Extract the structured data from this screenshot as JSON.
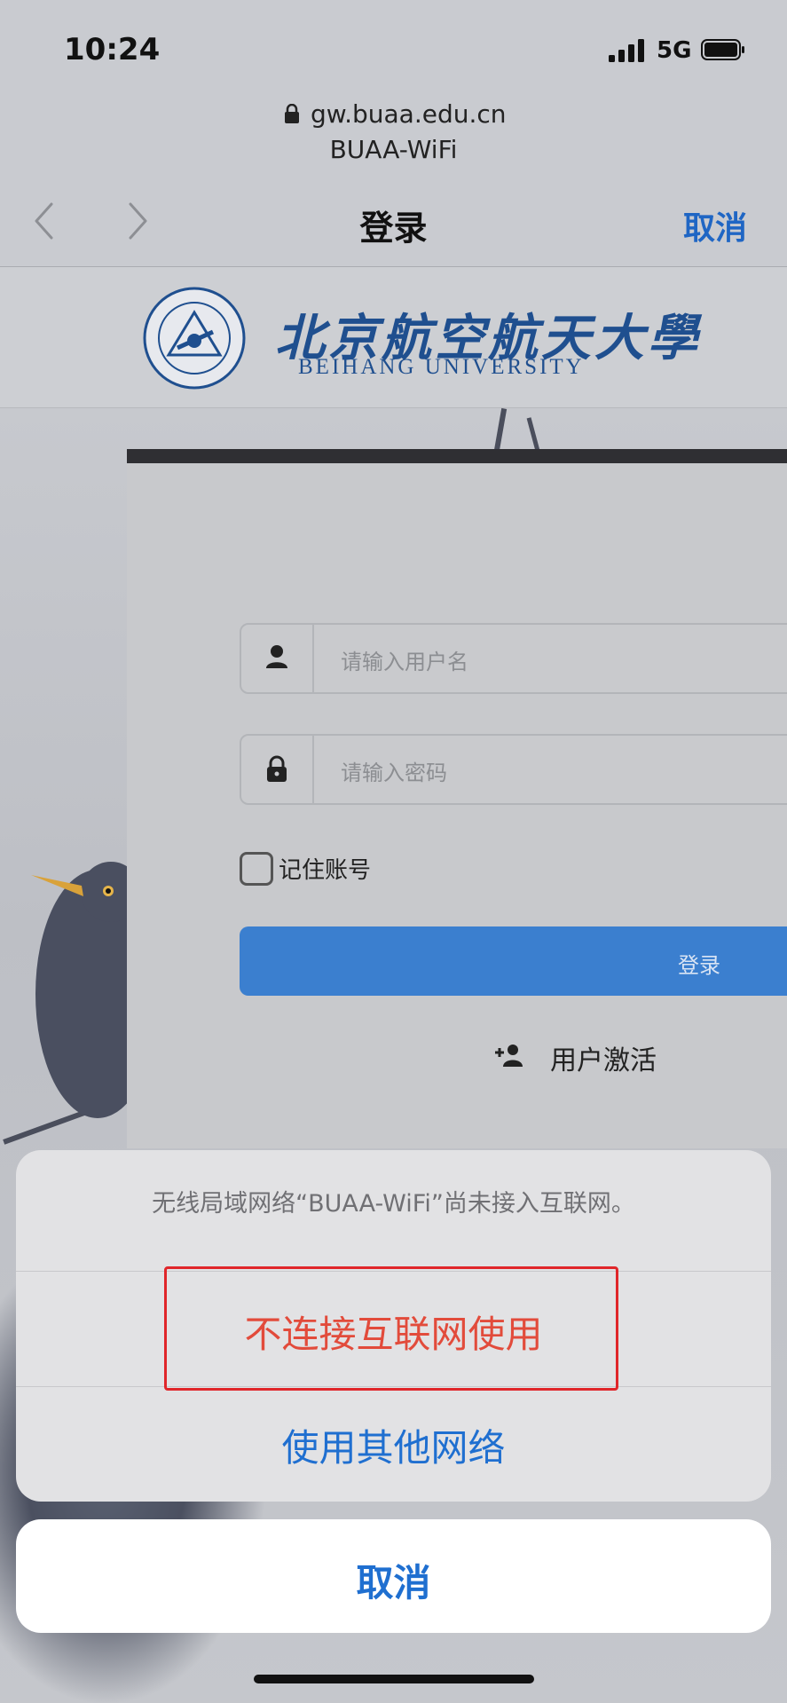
{
  "status": {
    "time": "10:24",
    "network": "5G"
  },
  "browser": {
    "url": "gw.buaa.edu.cn",
    "subtitle": "BUAA-WiFi",
    "title": "登录",
    "cancel": "取消"
  },
  "site": {
    "name_cn": "北京航空航天大學",
    "name_en": "BEIHANG UNIVERSITY"
  },
  "login": {
    "username_placeholder": "请输入用户名",
    "password_placeholder": "请输入密码",
    "remember_label": "记住账号",
    "remember_checked": false,
    "login_button": "登录",
    "activate_label": "用户激活"
  },
  "action_sheet": {
    "message": "无线局域网络“BUAA-WiFi”尚未接入互联网。",
    "option_no_internet": "不连接互联网使用",
    "option_other_network": "使用其他网络",
    "cancel": "取消"
  },
  "colors": {
    "accent_blue": "#1f6fd0",
    "destructive_red": "#e24b3b",
    "login_button": "#3b7fcf",
    "highlight_box": "#e0262a"
  }
}
